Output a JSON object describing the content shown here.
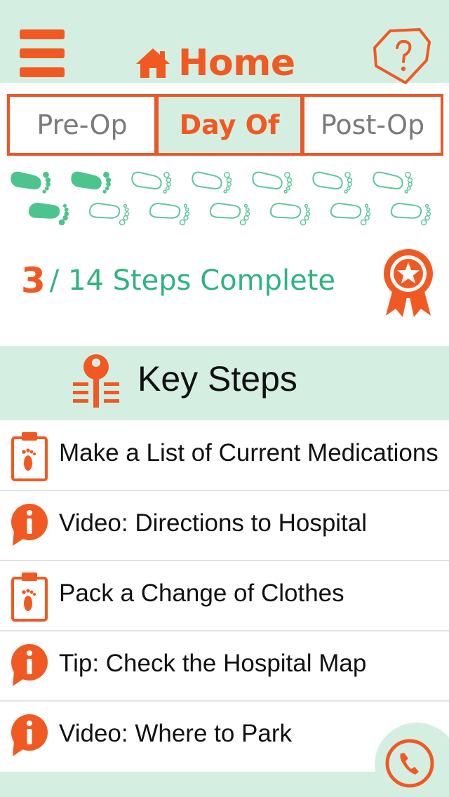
{
  "header": {
    "title": "Home",
    "menu_icon": "hamburger-menu-icon",
    "help_icon": "shield-question-icon"
  },
  "tabs": [
    {
      "label": "Pre-Op",
      "active": false
    },
    {
      "label": "Day Of",
      "active": true
    },
    {
      "label": "Post-Op",
      "active": false
    }
  ],
  "footprints": {
    "completed": 3,
    "total": 14
  },
  "progress": {
    "completed": "3",
    "suffix": "/ 14 Steps Complete",
    "icon": "award-ribbon-icon"
  },
  "key_steps": {
    "title": "Key Steps",
    "icon": "key-icon",
    "items": [
      {
        "label": "Make a List of Current Medications",
        "icon": "clipboard-footprint-icon"
      },
      {
        "label": "Video: Directions to Hospital",
        "icon": "info-bubble-icon"
      },
      {
        "label": "Pack a Change of Clothes",
        "icon": "clipboard-footprint-icon"
      },
      {
        "label": "Tip: Check the Hospital Map",
        "icon": "info-bubble-icon"
      },
      {
        "label": "Video: Where to Park",
        "icon": "info-bubble-icon"
      }
    ]
  },
  "call_button": {
    "icon": "phone-icon"
  },
  "colors": {
    "accent": "#f05a22",
    "mint": "#d4efe2",
    "green": "#2fb37f",
    "footprint_done": "#4cc48d",
    "footprint_todo": "#5fc79a"
  }
}
